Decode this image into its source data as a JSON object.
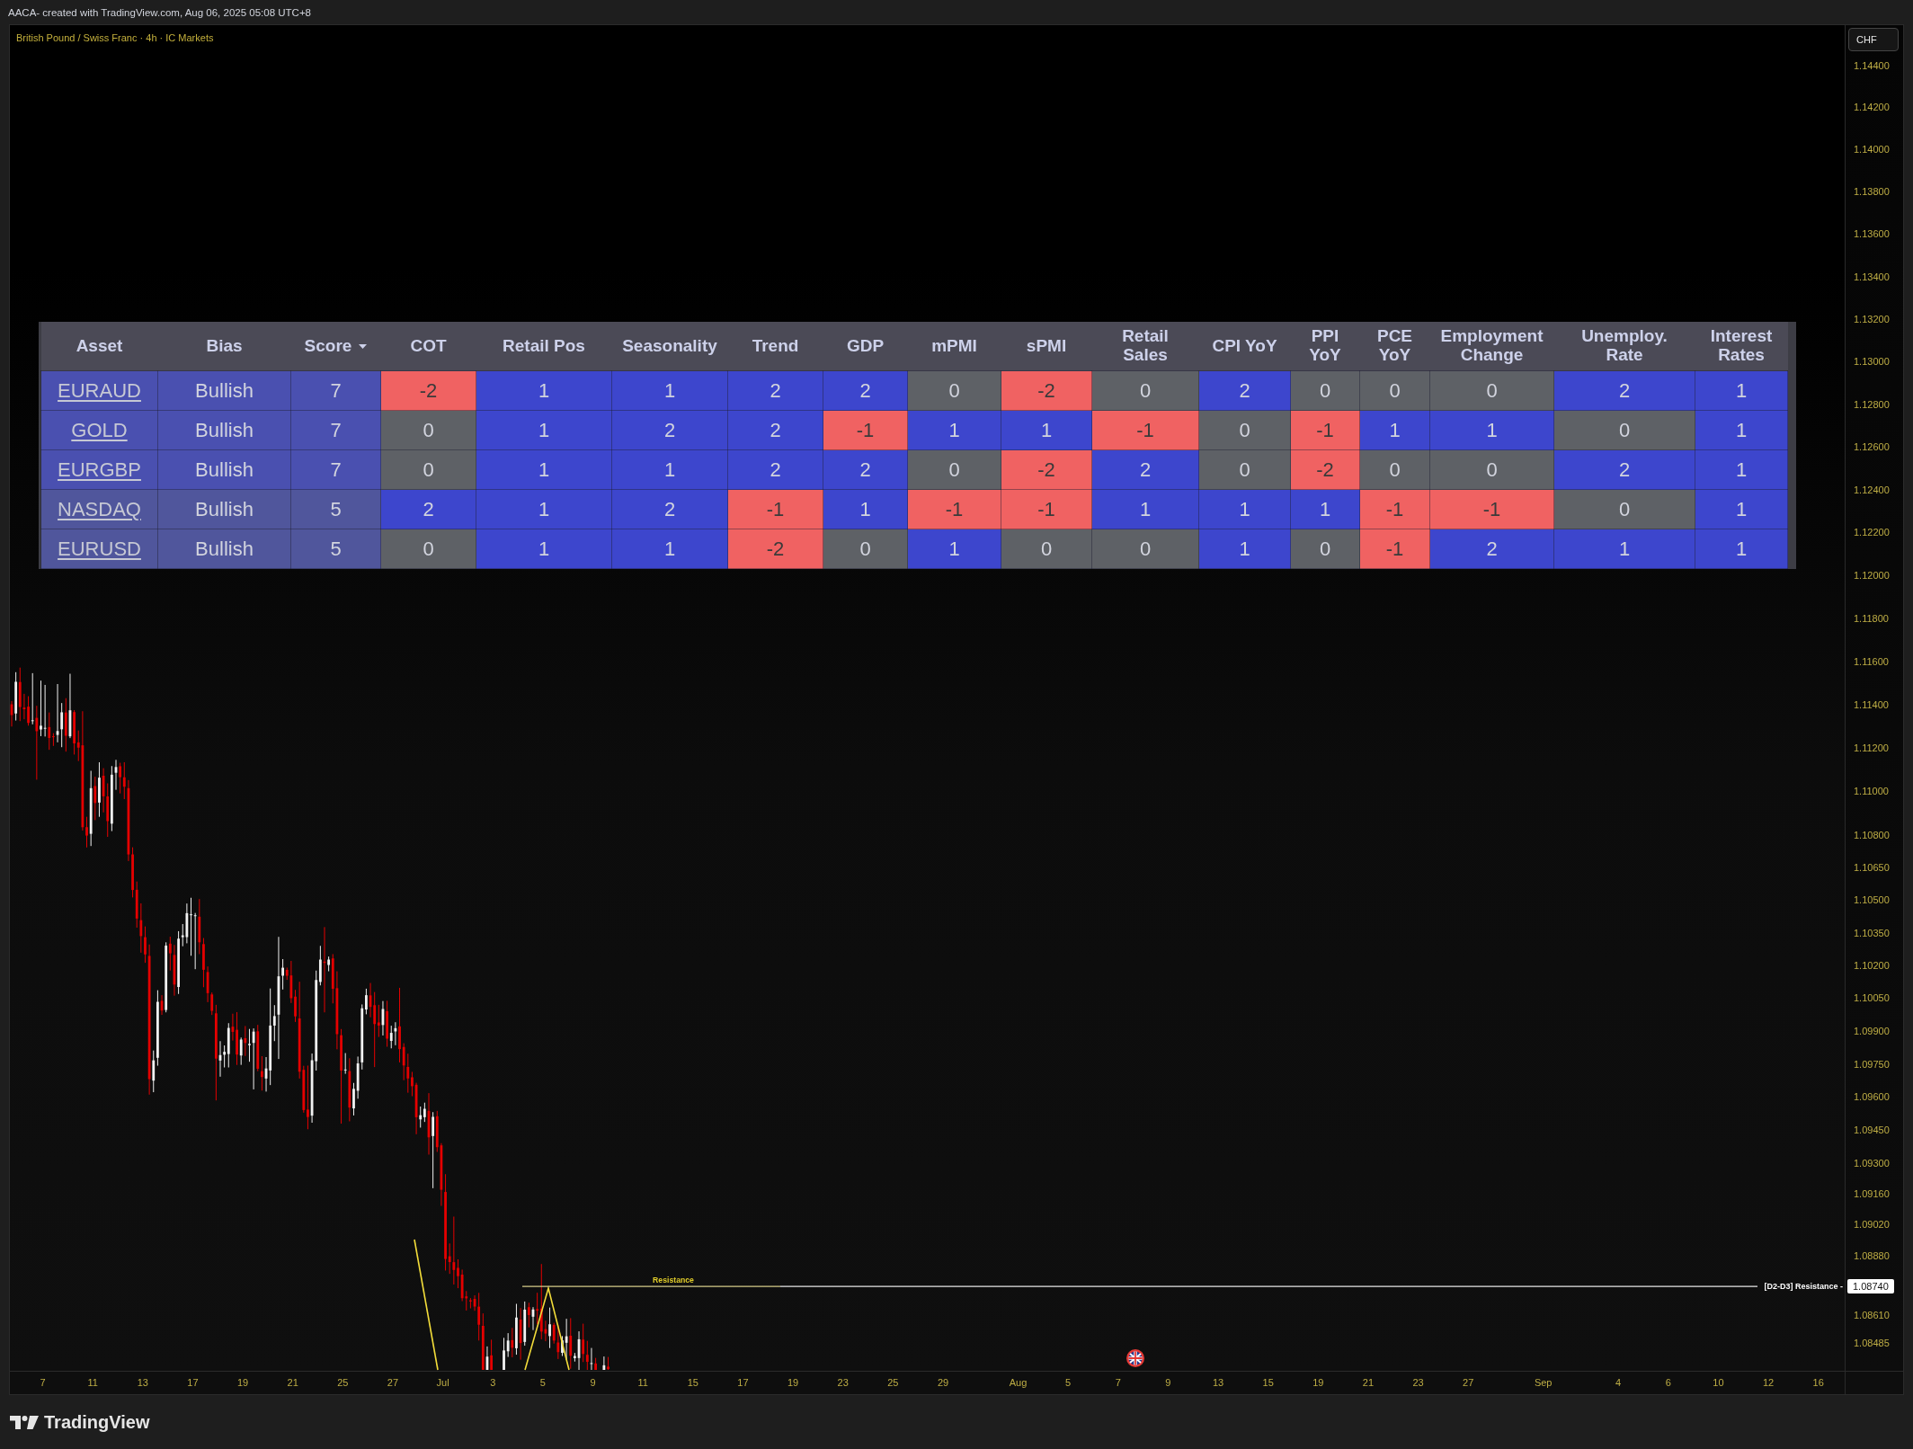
{
  "caption": "AACA- created with TradingView.com, Aug 06, 2025 05:08 UTC+8",
  "chart": {
    "legend": "British Pound / Swiss Franc · 4h · IC Markets",
    "currency_button": "CHF",
    "table": {
      "columns": [
        {
          "label": "Asset",
          "sorted": false
        },
        {
          "label": "Bias",
          "sorted": false
        },
        {
          "label": "Score",
          "sorted": true
        },
        {
          "label": "COT",
          "sorted": false
        },
        {
          "label": "Retail Pos",
          "sorted": false
        },
        {
          "label": "Seasonality",
          "sorted": false
        },
        {
          "label": "Trend",
          "sorted": false
        },
        {
          "label": "GDP",
          "sorted": false
        },
        {
          "label": "mPMI",
          "sorted": false
        },
        {
          "label": "sPMI",
          "sorted": false
        },
        {
          "label": "Retail\nSales",
          "sorted": false
        },
        {
          "label": "CPI YoY",
          "sorted": false
        },
        {
          "label": "PPI\nYoY",
          "sorted": false
        },
        {
          "label": "PCE\nYoY",
          "sorted": false
        },
        {
          "label": "Employment\nChange",
          "sorted": false
        },
        {
          "label": "Unemploy.\nRate",
          "sorted": false
        },
        {
          "label": "Interest\nRates",
          "sorted": false
        }
      ],
      "rows": [
        {
          "cells": [
            {
              "kind": "link",
              "value": "EURAUD",
              "color": "#4a50b0"
            },
            {
              "kind": "text",
              "value": "Bullish",
              "color": "#4a50b0"
            },
            {
              "kind": "text",
              "value": "7",
              "color": "#4a50b0"
            },
            {
              "kind": "text",
              "value": "-2",
              "color": "#f06262"
            },
            {
              "kind": "text",
              "value": "1",
              "color": "#3d46cd"
            },
            {
              "kind": "text",
              "value": "1",
              "color": "#3d46cd"
            },
            {
              "kind": "text",
              "value": "2",
              "color": "#3d46cd"
            },
            {
              "kind": "text",
              "value": "2",
              "color": "#3d46cd"
            },
            {
              "kind": "text",
              "value": "0",
              "color": "#5e6166"
            },
            {
              "kind": "text",
              "value": "-2",
              "color": "#f06262"
            },
            {
              "kind": "text",
              "value": "0",
              "color": "#5e6166"
            },
            {
              "kind": "text",
              "value": "2",
              "color": "#3d46cd"
            },
            {
              "kind": "text",
              "value": "0",
              "color": "#5e6166"
            },
            {
              "kind": "text",
              "value": "0",
              "color": "#5e6166"
            },
            {
              "kind": "text",
              "value": "0",
              "color": "#5e6166"
            },
            {
              "kind": "text",
              "value": "2",
              "color": "#3d46cd"
            },
            {
              "kind": "text",
              "value": "1",
              "color": "#3d46cd"
            }
          ]
        },
        {
          "cells": [
            {
              "kind": "link",
              "value": "GOLD",
              "color": "#4a50b0"
            },
            {
              "kind": "text",
              "value": "Bullish",
              "color": "#4a50b0"
            },
            {
              "kind": "text",
              "value": "7",
              "color": "#4a50b0"
            },
            {
              "kind": "text",
              "value": "0",
              "color": "#5e6166"
            },
            {
              "kind": "text",
              "value": "1",
              "color": "#3d46cd"
            },
            {
              "kind": "text",
              "value": "2",
              "color": "#3d46cd"
            },
            {
              "kind": "text",
              "value": "2",
              "color": "#3d46cd"
            },
            {
              "kind": "text",
              "value": "-1",
              "color": "#f06262"
            },
            {
              "kind": "text",
              "value": "1",
              "color": "#3d46cd"
            },
            {
              "kind": "text",
              "value": "1",
              "color": "#3d46cd"
            },
            {
              "kind": "text",
              "value": "-1",
              "color": "#f06262"
            },
            {
              "kind": "text",
              "value": "0",
              "color": "#5e6166"
            },
            {
              "kind": "text",
              "value": "-1",
              "color": "#f06262"
            },
            {
              "kind": "text",
              "value": "1",
              "color": "#3d46cd"
            },
            {
              "kind": "text",
              "value": "1",
              "color": "#3d46cd"
            },
            {
              "kind": "text",
              "value": "0",
              "color": "#5e6166"
            },
            {
              "kind": "text",
              "value": "1",
              "color": "#3d46cd"
            }
          ]
        },
        {
          "cells": [
            {
              "kind": "link",
              "value": "EURGBP",
              "color": "#4a50b0"
            },
            {
              "kind": "text",
              "value": "Bullish",
              "color": "#4a50b0"
            },
            {
              "kind": "text",
              "value": "7",
              "color": "#4a50b0"
            },
            {
              "kind": "text",
              "value": "0",
              "color": "#5e6166"
            },
            {
              "kind": "text",
              "value": "1",
              "color": "#3d46cd"
            },
            {
              "kind": "text",
              "value": "1",
              "color": "#3d46cd"
            },
            {
              "kind": "text",
              "value": "2",
              "color": "#3d46cd"
            },
            {
              "kind": "text",
              "value": "2",
              "color": "#3d46cd"
            },
            {
              "kind": "text",
              "value": "0",
              "color": "#5e6166"
            },
            {
              "kind": "text",
              "value": "-2",
              "color": "#f06262"
            },
            {
              "kind": "text",
              "value": "2",
              "color": "#3d46cd"
            },
            {
              "kind": "text",
              "value": "0",
              "color": "#5e6166"
            },
            {
              "kind": "text",
              "value": "-2",
              "color": "#f06262"
            },
            {
              "kind": "text",
              "value": "0",
              "color": "#5e6166"
            },
            {
              "kind": "text",
              "value": "0",
              "color": "#5e6166"
            },
            {
              "kind": "text",
              "value": "2",
              "color": "#3d46cd"
            },
            {
              "kind": "text",
              "value": "1",
              "color": "#3d46cd"
            }
          ]
        },
        {
          "cells": [
            {
              "kind": "link",
              "value": "NASDAQ",
              "color": "#50569c"
            },
            {
              "kind": "text",
              "value": "Bullish",
              "color": "#50569c"
            },
            {
              "kind": "text",
              "value": "5",
              "color": "#50569c"
            },
            {
              "kind": "text",
              "value": "2",
              "color": "#3d46cd"
            },
            {
              "kind": "text",
              "value": "1",
              "color": "#3d46cd"
            },
            {
              "kind": "text",
              "value": "2",
              "color": "#3d46cd"
            },
            {
              "kind": "text",
              "value": "-1",
              "color": "#f06262"
            },
            {
              "kind": "text",
              "value": "1",
              "color": "#3d46cd"
            },
            {
              "kind": "text",
              "value": "-1",
              "color": "#f06262"
            },
            {
              "kind": "text",
              "value": "-1",
              "color": "#f06262"
            },
            {
              "kind": "text",
              "value": "1",
              "color": "#3d46cd"
            },
            {
              "kind": "text",
              "value": "1",
              "color": "#3d46cd"
            },
            {
              "kind": "text",
              "value": "1",
              "color": "#3d46cd"
            },
            {
              "kind": "text",
              "value": "-1",
              "color": "#f06262"
            },
            {
              "kind": "text",
              "value": "-1",
              "color": "#f06262"
            },
            {
              "kind": "text",
              "value": "0",
              "color": "#5e6166"
            },
            {
              "kind": "text",
              "value": "1",
              "color": "#3d46cd"
            }
          ]
        },
        {
          "cells": [
            {
              "kind": "link",
              "value": "EURUSD",
              "color": "#50569c"
            },
            {
              "kind": "text",
              "value": "Bullish",
              "color": "#50569c"
            },
            {
              "kind": "text",
              "value": "5",
              "color": "#50569c"
            },
            {
              "kind": "text",
              "value": "0",
              "color": "#5e6166"
            },
            {
              "kind": "text",
              "value": "1",
              "color": "#3d46cd"
            },
            {
              "kind": "text",
              "value": "1",
              "color": "#3d46cd"
            },
            {
              "kind": "text",
              "value": "-2",
              "color": "#f06262"
            },
            {
              "kind": "text",
              "value": "0",
              "color": "#5e6166"
            },
            {
              "kind": "text",
              "value": "1",
              "color": "#3d46cd"
            },
            {
              "kind": "text",
              "value": "0",
              "color": "#5e6166"
            },
            {
              "kind": "text",
              "value": "0",
              "color": "#5e6166"
            },
            {
              "kind": "text",
              "value": "1",
              "color": "#3d46cd"
            },
            {
              "kind": "text",
              "value": "0",
              "color": "#5e6166"
            },
            {
              "kind": "text",
              "value": "-1",
              "color": "#f06262"
            },
            {
              "kind": "text",
              "value": "2",
              "color": "#3d46cd"
            },
            {
              "kind": "text",
              "value": "1",
              "color": "#3d46cd"
            },
            {
              "kind": "text",
              "value": "1",
              "color": "#3d46cd"
            }
          ]
        }
      ]
    },
    "resistance": {
      "label": "Resistance",
      "tag": "[D2-D3] Resistance -",
      "price": "1.08740"
    },
    "price_axis": [
      "1.14400",
      "1.14200",
      "1.14000",
      "1.13800",
      "1.13600",
      "1.13400",
      "1.13200",
      "1.13000",
      "1.12800",
      "1.12600",
      "1.12400",
      "1.12200",
      "1.12000",
      "1.11800",
      "1.11600",
      "1.11400",
      "1.11200",
      "1.11000",
      "1.10800",
      "1.10650",
      "1.10500",
      "1.10350",
      "1.10200",
      "1.10050",
      "1.09900",
      "1.09750",
      "1.09600",
      "1.09450",
      "1.09300",
      "1.09160",
      "1.09020",
      "1.08880",
      "1.08610",
      "1.08485"
    ],
    "time_axis": [
      "7",
      "11",
      "13",
      "17",
      "19",
      "21",
      "25",
      "27",
      "Jul",
      "3",
      "5",
      "9",
      "11",
      "15",
      "17",
      "19",
      "23",
      "25",
      "29",
      "Aug",
      "5",
      "7",
      "9",
      "13",
      "15",
      "19",
      "21",
      "23",
      "27",
      "Sep",
      "4",
      "6",
      "10",
      "12",
      "16"
    ]
  },
  "footer": {
    "brand": "TradingView"
  }
}
